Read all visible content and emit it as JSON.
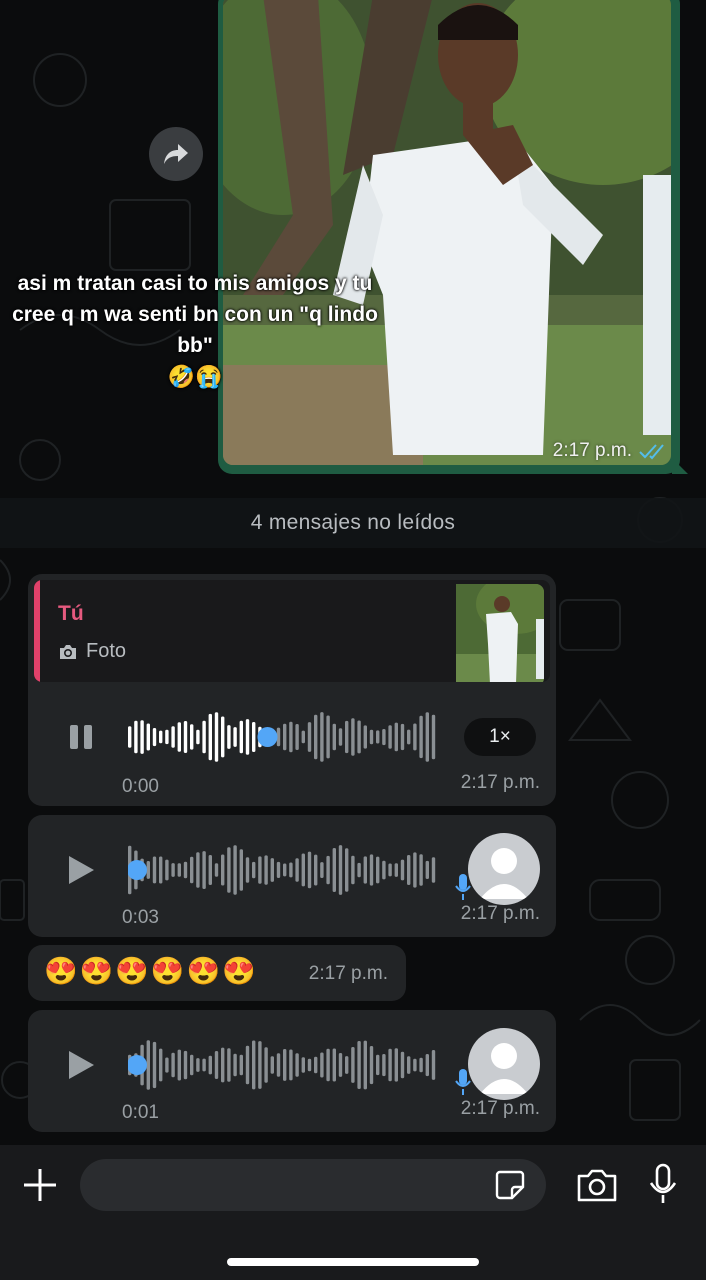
{
  "overlay_caption": {
    "text": "asi m tratan casi to mis amigos y tu cree q m wa senti bn con un \"q lindo bb\"",
    "emojis": "🤣😭"
  },
  "photo_message": {
    "time": "2:17 p.m.",
    "status": "read"
  },
  "unread_separator": {
    "label": "4 mensajes no leídos"
  },
  "messages": [
    {
      "type": "voice",
      "quote": {
        "author": "Tú",
        "kind_label": "Foto",
        "kind_icon": "camera-icon"
      },
      "state": "playing",
      "progress": 0.45,
      "duration": "0:00",
      "speed": "1×",
      "time": "2:17 p.m."
    },
    {
      "type": "voice",
      "state": "paused",
      "progress": 0,
      "duration": "0:03",
      "time": "2:17 p.m."
    },
    {
      "type": "emoji",
      "text": "😍😍😍😍😍😍",
      "time": "2:17 p.m."
    },
    {
      "type": "voice",
      "state": "paused",
      "progress": 0,
      "duration": "0:01",
      "time": "2:17 p.m."
    }
  ],
  "composer": {
    "placeholder": "",
    "value": ""
  },
  "colors": {
    "background": "#0b0c0d",
    "outgoing_border": "#1f5c42",
    "incoming_bubble": "#222426",
    "accent_blue": "#53a6f7",
    "quote_author": "#e65a7f",
    "read_ticks": "#53bdeb"
  }
}
